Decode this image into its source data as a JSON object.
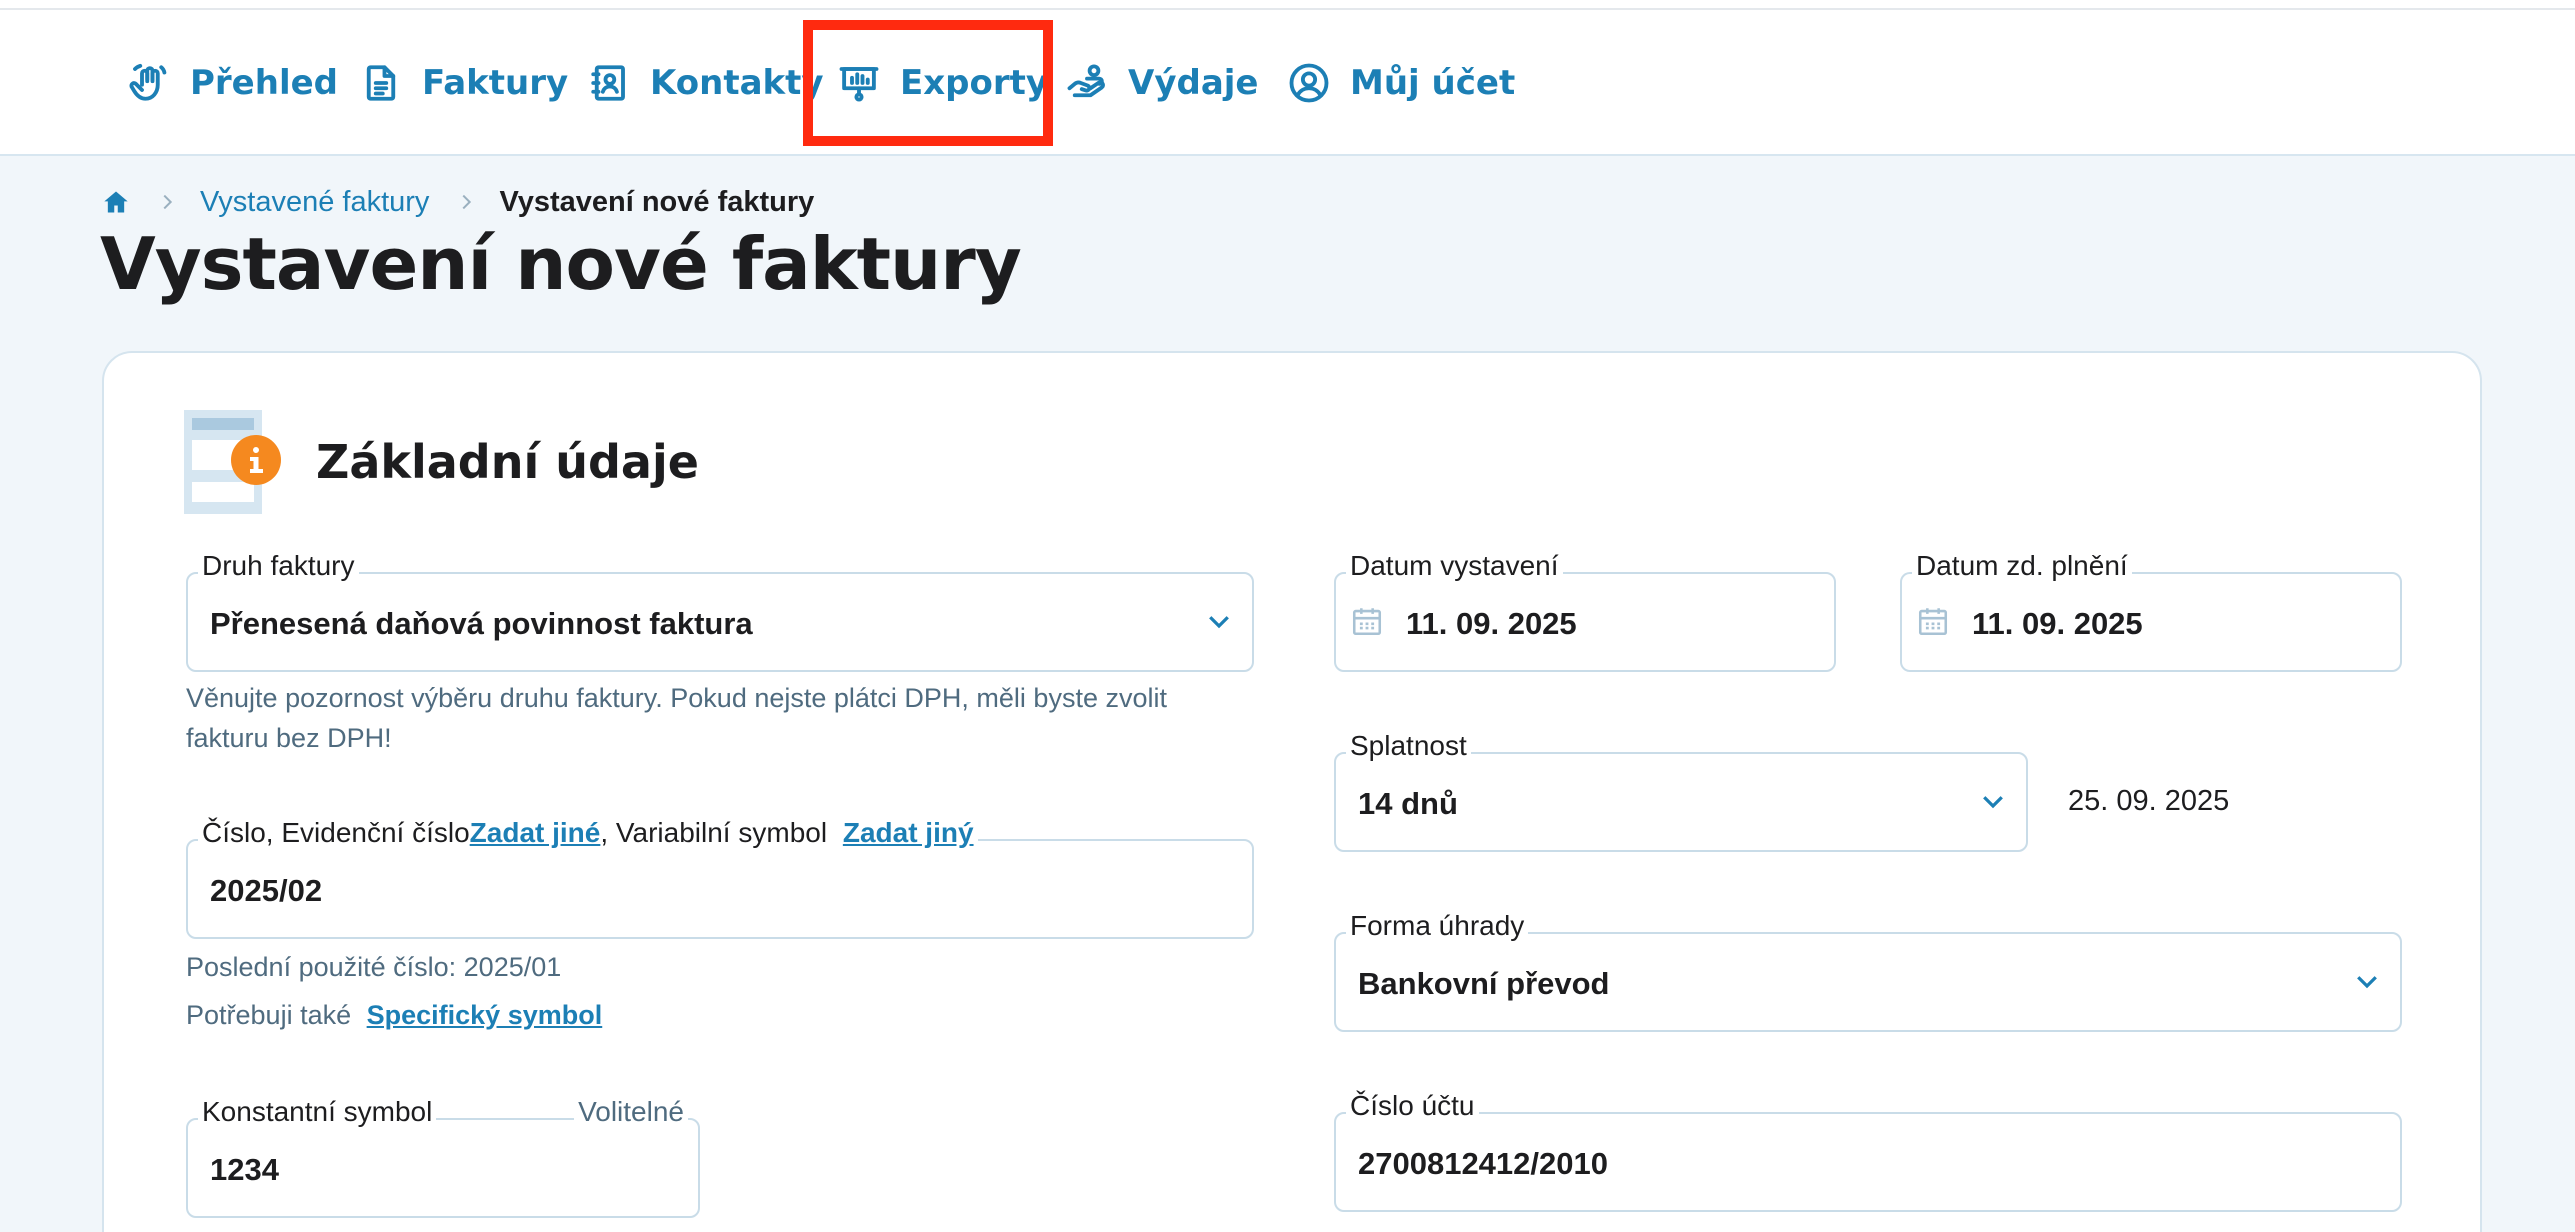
{
  "nav": {
    "items": [
      {
        "label": "Přehled",
        "icon": "wave-hand-icon"
      },
      {
        "label": "Faktury",
        "icon": "document-icon"
      },
      {
        "label": "Kontakty",
        "icon": "contact-card-icon"
      },
      {
        "label": "Exporty",
        "icon": "presentation-chart-icon"
      },
      {
        "label": "Výdaje",
        "icon": "hand-coins-icon"
      },
      {
        "label": "Můj účet",
        "icon": "user-circle-icon"
      }
    ],
    "highlight_color": "#ff2a0f"
  },
  "breadcrumb": {
    "parent": "Vystavené faktury",
    "current": "Vystavení nové faktury"
  },
  "page_title": "Vystavení nové faktury",
  "section": {
    "title": "Základní údaje"
  },
  "form": {
    "invoice_type": {
      "label": "Druh faktury",
      "value": "Přenesená daňová povinnost faktura",
      "help": "Věnujte pozornost výběru druhu faktury. Pokud nejste plátci DPH, měli byste zvolit fakturu bez DPH!"
    },
    "number": {
      "label_prefix": "Číslo, Evidenční číslo",
      "link_other": "Zadat jiné",
      "label_mid": ", Variabilní symbol",
      "link_other_vs": "Zadat jiný",
      "value": "2025/02",
      "last_used": "Poslední použité číslo: 2025/01",
      "need_also": "Potřebuji také",
      "specific_symbol_link": "Specifický symbol"
    },
    "constant_symbol": {
      "label": "Konstantní symbol",
      "optional": "Volitelné",
      "value": "1234"
    },
    "issue_date": {
      "label": "Datum vystavení",
      "value": "11. 09. 2025"
    },
    "tax_date": {
      "label": "Datum zd. plnění",
      "value": "11. 09. 2025"
    },
    "due": {
      "label": "Splatnost",
      "value": "14 dnů",
      "due_date": "25. 09. 2025"
    },
    "payment_method": {
      "label": "Forma úhrady",
      "value": "Bankovní převod"
    },
    "account_number": {
      "label": "Číslo účtu",
      "value": "2700812412/2010"
    }
  },
  "colors": {
    "accent": "#1c7fb5",
    "page_bg": "#f1f6fa",
    "info_badge": "#f5891f"
  }
}
